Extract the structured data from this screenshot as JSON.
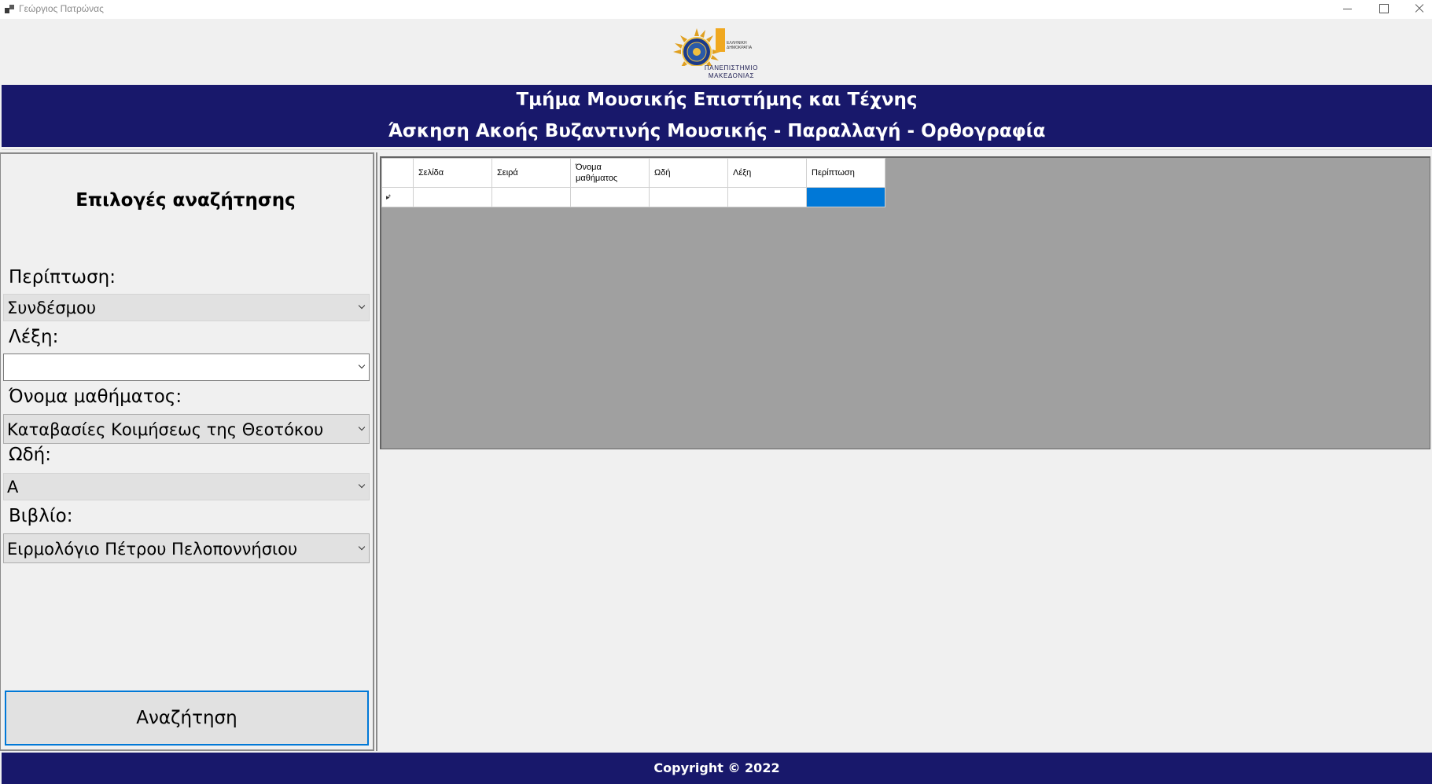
{
  "window": {
    "title": "Γεώργιος Πατρώνας"
  },
  "logo": {
    "line1": "ΠΑΝΕΠΙΣΤΗΜΙΟ",
    "line2": "ΜΑΚΕΔΟΝΙΑΣ",
    "small1": "ΕΛΛΗΝΙΚΗ",
    "small2": "ΔΗΜΟΚΡΑΤΙΑ"
  },
  "header": {
    "line1": "Τμήμα Μουσικής Επιστήμης και Τέχνης",
    "line2": "Άσκηση Ακοής Βυζαντινής Μουσικής - Παραλλαγή - Ορθογραφία"
  },
  "search_panel": {
    "title": "Επιλογές αναζήτησης",
    "fields": {
      "case": {
        "label": "Περίπτωση:",
        "value": "Συνδέσμου"
      },
      "word": {
        "label": "Λέξη:",
        "value": ""
      },
      "lesson": {
        "label": "Όνομα μαθήματος:",
        "value": "Καταβασίες Κοιμήσεως της Θεοτόκου"
      },
      "ode": {
        "label": "Ωδή:",
        "value": "Α"
      },
      "book": {
        "label": "Βιβλίο:",
        "value": "Ειρμολόγιο Πέτρου Πελοποννήσιου"
      }
    },
    "search_button": "Αναζήτηση"
  },
  "grid": {
    "columns": [
      "Σελίδα",
      "Σειρά",
      "Όνομα μαθήματος",
      "Ωδή",
      "Λέξη",
      "Περίπτωση"
    ],
    "new_row_marker": "▸*"
  },
  "footer": {
    "text": "Copyright © 2022"
  },
  "colors": {
    "banner": "#18186b",
    "selection": "#0078d7",
    "grid_background": "#a0a0a0"
  }
}
